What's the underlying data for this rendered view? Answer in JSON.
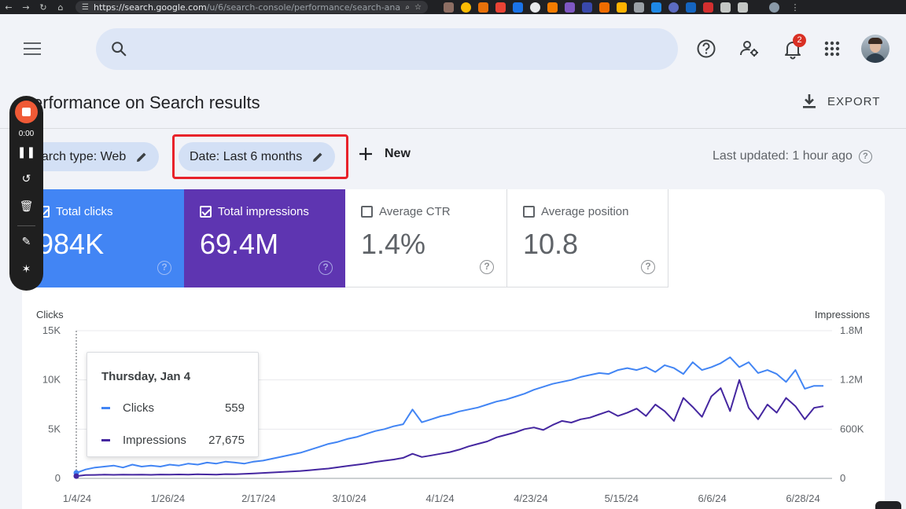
{
  "browser": {
    "url_host": "https://search.google.com",
    "url_path": "/u/6/search-console/performance/search-analy..."
  },
  "header": {
    "notification_count": "2"
  },
  "page": {
    "title": "erformance on Search results",
    "export_label": "EXPORT"
  },
  "filters": {
    "search_type": "earch type: Web",
    "date": "Date: Last 6 months",
    "new_label": "New",
    "last_updated": "Last updated: 1 hour ago"
  },
  "metrics": [
    {
      "label": "Total clicks",
      "value": "984K",
      "checked": true
    },
    {
      "label": "Total impressions",
      "value": "69.4M",
      "checked": true
    },
    {
      "label": "Average CTR",
      "value": "1.4%",
      "checked": false
    },
    {
      "label": "Average position",
      "value": "10.8",
      "checked": false
    }
  ],
  "recorder": {
    "time": "0:00"
  },
  "tooltip": {
    "date": "Thursday, Jan 4",
    "rows": [
      {
        "name": "Clicks",
        "value": "559",
        "color": "#4285f4"
      },
      {
        "name": "Impressions",
        "value": "27,675",
        "color": "#4527a0"
      }
    ]
  },
  "chart_data": {
    "type": "line",
    "ylabel_left": "Clicks",
    "ylabel_right": "Impressions",
    "y_left_ticks": [
      "0",
      "5K",
      "10K",
      "15K"
    ],
    "y_right_ticks": [
      "0",
      "600K",
      "1.2M",
      "1.8M"
    ],
    "ylim_left": [
      0,
      15000
    ],
    "ylim_right": [
      0,
      1800000
    ],
    "x_tick_labels": [
      "1/4/24",
      "1/26/24",
      "2/17/24",
      "3/10/24",
      "4/1/24",
      "4/23/24",
      "5/15/24",
      "6/6/24",
      "6/28/24"
    ],
    "series": [
      {
        "name": "Clicks",
        "color": "#4285f4",
        "axis": "left",
        "values": [
          559,
          900,
          1100,
          1200,
          1300,
          1100,
          1400,
          1200,
          1300,
          1200,
          1400,
          1300,
          1500,
          1400,
          1600,
          1500,
          1700,
          1600,
          1500,
          1700,
          1800,
          2000,
          2200,
          2400,
          2600,
          2900,
          3200,
          3500,
          3700,
          4000,
          4200,
          4500,
          4800,
          5000,
          5300,
          5500,
          7000,
          5700,
          6000,
          6300,
          6500,
          6800,
          7000,
          7200,
          7500,
          7800,
          8000,
          8300,
          8600,
          9000,
          9300,
          9600,
          9800,
          10000,
          10300,
          10500,
          10700,
          10600,
          11000,
          11200,
          11000,
          11300,
          10800,
          11500,
          11200,
          10600,
          11800,
          11000,
          11300,
          11700,
          12300,
          11300,
          11800,
          10700,
          11000,
          10600,
          9800,
          11000,
          9100,
          9400,
          9400
        ]
      },
      {
        "name": "Impressions",
        "color": "#4527a0",
        "axis": "right",
        "values": [
          27675,
          40000,
          42000,
          45000,
          43000,
          46000,
          44000,
          45000,
          43000,
          47000,
          45000,
          48000,
          46000,
          50000,
          48000,
          46000,
          52000,
          50000,
          56000,
          60000,
          66000,
          72000,
          78000,
          84000,
          90000,
          100000,
          110000,
          120000,
          135000,
          150000,
          165000,
          180000,
          200000,
          215000,
          230000,
          250000,
          300000,
          260000,
          280000,
          300000,
          320000,
          350000,
          390000,
          420000,
          450000,
          500000,
          530000,
          560000,
          600000,
          620000,
          590000,
          650000,
          700000,
          680000,
          720000,
          740000,
          780000,
          820000,
          760000,
          800000,
          850000,
          760000,
          900000,
          820000,
          700000,
          980000,
          870000,
          750000,
          1000000,
          1100000,
          820000,
          1200000,
          860000,
          720000,
          900000,
          800000,
          980000,
          880000,
          720000,
          860000,
          880000
        ]
      }
    ]
  }
}
